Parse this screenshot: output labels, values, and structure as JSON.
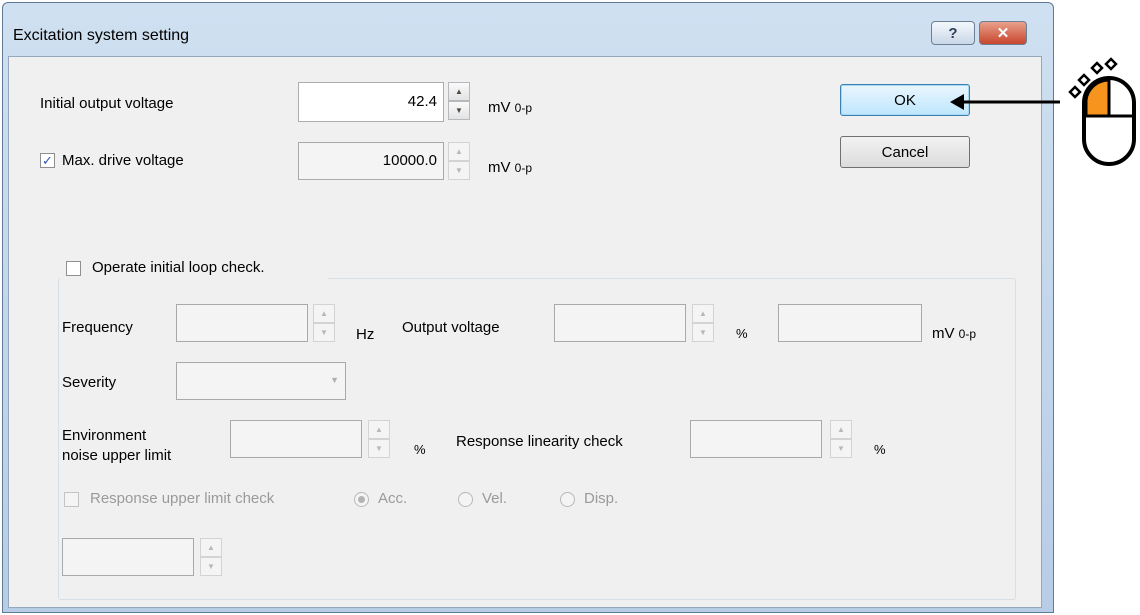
{
  "window": {
    "title": "Excitation system setting",
    "help_label": "?",
    "close_label": "✕"
  },
  "initial_output_voltage": {
    "label": "Initial output voltage",
    "value": "42.4",
    "unit": "mV",
    "unit_sub": "0-p"
  },
  "max_drive_voltage": {
    "label": "Max. drive voltage",
    "checked": true,
    "check_glyph": "✓",
    "value": "10000.0",
    "unit": "mV",
    "unit_sub": "0-p"
  },
  "buttons": {
    "ok": "OK",
    "cancel": "Cancel"
  },
  "loop_check": {
    "label": "Operate initial loop check.",
    "checked": false,
    "frequency": {
      "label": "Frequency",
      "value": "",
      "unit": "Hz"
    },
    "output_voltage": {
      "label": "Output voltage",
      "value": "",
      "unit": "%",
      "mv_value": "",
      "mv_unit": "mV",
      "mv_unit_sub": "0-p"
    },
    "severity": {
      "label": "Severity",
      "value": ""
    },
    "env_noise": {
      "label_line1": "Environment",
      "label_line2": "noise upper limit",
      "value": "",
      "unit": "%"
    },
    "response_linearity": {
      "label": "Response linearity check",
      "value": "",
      "unit": "%"
    },
    "response_upper_limit": {
      "label": "Response upper limit check",
      "checked": false,
      "value": ""
    },
    "radios": [
      {
        "label": "Acc.",
        "selected": true
      },
      {
        "label": "Vel.",
        "selected": false
      },
      {
        "label": "Disp.",
        "selected": false
      }
    ]
  },
  "spinner_glyphs": {
    "up": "▲",
    "down": "▼"
  },
  "combo_arrow": "▼",
  "annotation": {
    "icon": "mouse-click-icon",
    "color": "#f7941d"
  }
}
